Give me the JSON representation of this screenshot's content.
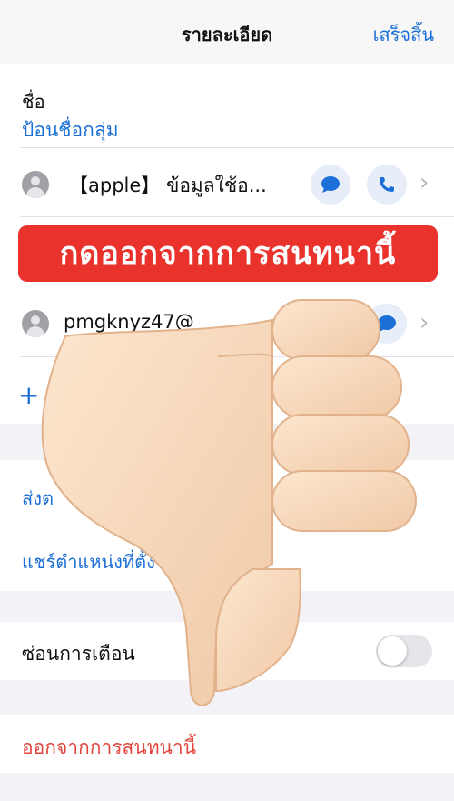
{
  "navbar": {
    "title": "รายละเอียด",
    "done_label": "เสร็จสิ้น"
  },
  "name_section": {
    "label": "ชื่อ",
    "placeholder": "ป้อนชื่อกลุ่ม"
  },
  "members": [
    {
      "name": "【apple】 ข้อมูลใช้อ..."
    },
    {
      "name": "pmgknyz47@"
    }
  ],
  "banner": {
    "text": "กดออกจากการสนทนานี้"
  },
  "add_member": {
    "icon": "plus-icon"
  },
  "actions": {
    "send_location_partial": "ส่งต",
    "share_location": "แชร์ตำแหน่งที่ตั้งข"
  },
  "settings": {
    "hide_alerts_label": "ซ่อนการเตือน",
    "hide_alerts_on": false
  },
  "leave": {
    "label": "ออกจากการสนทนานี้"
  },
  "overlay": {
    "icon": "thumbs-down-icon"
  },
  "colors": {
    "accent": "#1b6fd6",
    "banner": "#e8322b",
    "destructive": "#e2453c"
  }
}
